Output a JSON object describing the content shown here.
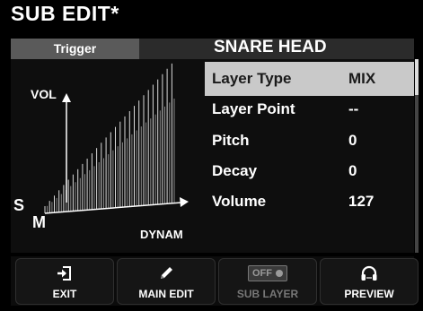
{
  "header": {
    "title": "SUB EDIT*",
    "tab": "Trigger",
    "instrument": "SNARE HEAD"
  },
  "graph": {
    "vol_label": "VOL",
    "dynam_label": "DYNAM",
    "s_label": "S",
    "m_label": "M"
  },
  "params": [
    {
      "label": "Layer Type",
      "value": "MIX",
      "selected": true
    },
    {
      "label": "Layer Point",
      "value": "--"
    },
    {
      "label": "Pitch",
      "value": "0"
    },
    {
      "label": "Decay",
      "value": "0"
    },
    {
      "label": "Volume",
      "value": "127"
    }
  ],
  "footer": {
    "exit": "EXIT",
    "main_edit": "MAIN EDIT",
    "sub_layer": "SUB LAYER",
    "sub_layer_state": "OFF",
    "preview": "PREVIEW"
  },
  "colors": {
    "selected_row": "#c9c9c9",
    "tab_bg": "#5a5a5a",
    "background": "#000000"
  }
}
